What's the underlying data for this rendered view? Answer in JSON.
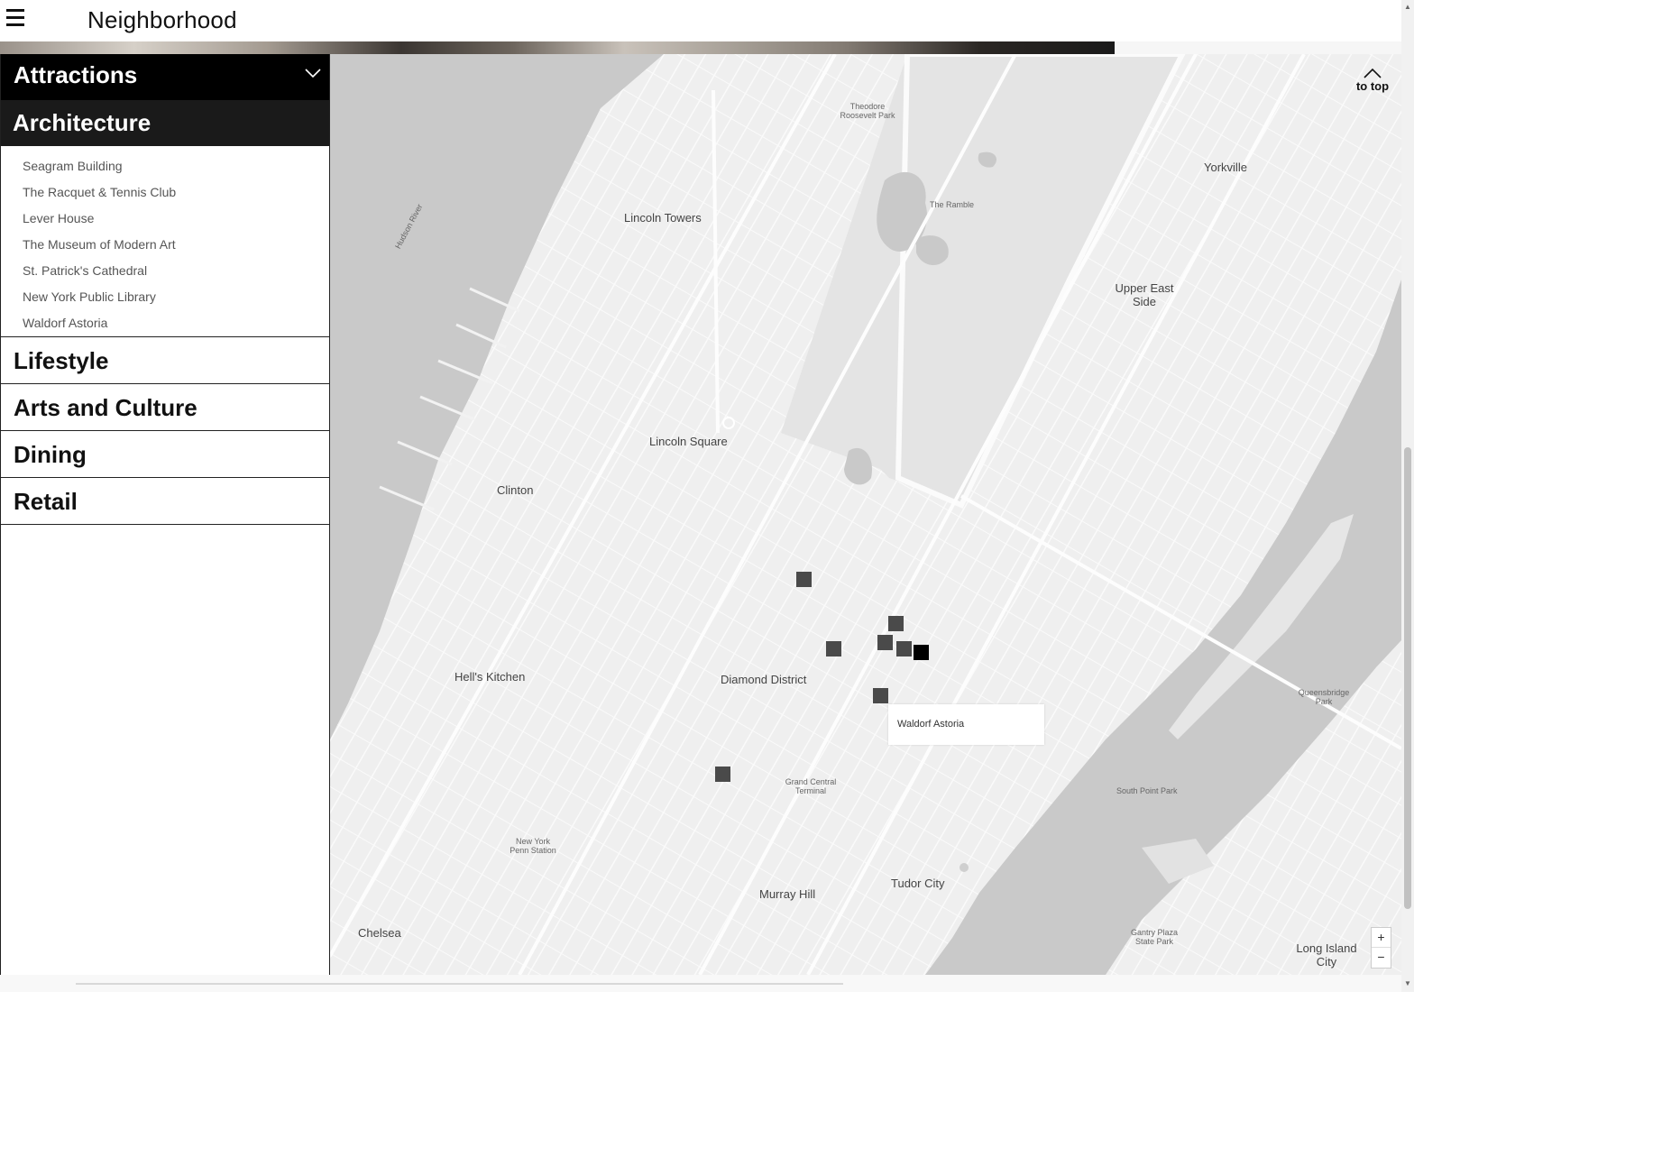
{
  "header": {
    "title": "Neighborhood",
    "menu_icon": "hamburger-menu-icon"
  },
  "sidebar": {
    "dropdown": {
      "label": "Attractions",
      "icon": "chevron-down-icon"
    },
    "active_category": "Architecture",
    "architecture_items": [
      "Seagram Building",
      "The Racquet & Tennis Club",
      "Lever House",
      "The Museum of Modern Art",
      "St. Patrick's Cathedral",
      "New York Public Library",
      "Waldorf Astoria"
    ],
    "categories": [
      "Lifestyle",
      "Arts and Culture",
      "Dining",
      "Retail"
    ]
  },
  "map": {
    "to_top": "to top",
    "popup": "Waldorf Astoria",
    "zoom_in": "+",
    "zoom_out": "−",
    "labels": {
      "lincoln_towers": "Lincoln Towers",
      "lincoln_square": "Lincoln Square",
      "clinton": "Clinton",
      "hells_kitchen": "Hell's Kitchen",
      "diamond_district": "Diamond District",
      "murray_hill": "Murray Hill",
      "tudor_city": "Tudor City",
      "chelsea": "Chelsea",
      "yorkville": "Yorkville",
      "upper_east_side": "Upper East Side",
      "the_ramble": "The Ramble",
      "long_island_city": "Long Island City",
      "hudson_river": "Hudson River",
      "roosevelt_park": "Theodore Roosevelt Park",
      "grand_central": "Grand Central Terminal",
      "penn_station": "New York Penn Station",
      "queensbridge_park": "Queensbridge Park",
      "south_point_park": "South Point Park",
      "gantry_park": "Gantry Plaza State Park"
    },
    "colors": {
      "water": "#c9c9c9",
      "land": "#efefef",
      "park": "#e2e2e2",
      "marker": "#4a4a4a",
      "marker_active": "#000000"
    }
  }
}
